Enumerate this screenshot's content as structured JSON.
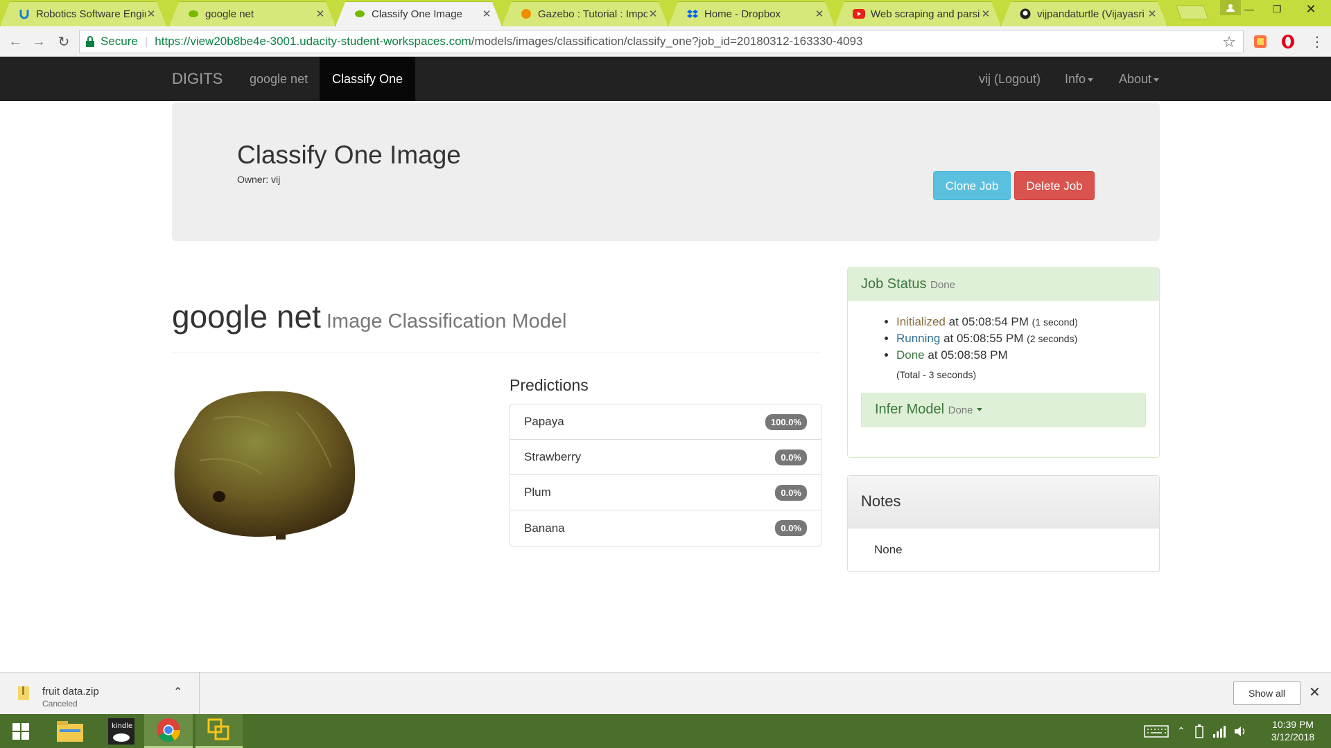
{
  "browser": {
    "tabs": [
      {
        "title": "Robotics Software Engin",
        "favicon": "udacity-icon"
      },
      {
        "title": "google net",
        "favicon": "nvidia-icon"
      },
      {
        "title": "Classify One Image",
        "favicon": "nvidia-icon",
        "active": true
      },
      {
        "title": "Gazebo : Tutorial : Impo",
        "favicon": "gazebo-icon"
      },
      {
        "title": "Home - Dropbox",
        "favicon": "dropbox-icon"
      },
      {
        "title": "Web scraping and parsin",
        "favicon": "youtube-icon"
      },
      {
        "title": "vijpandaturtle (Vijayasri",
        "favicon": "github-icon"
      }
    ],
    "secure_label": "Secure",
    "url_host": "https://view20b8be4e-3001.udacity-student-workspaces.com",
    "url_path": "/models/images/classification/classify_one?job_id=20180312-163330-4093"
  },
  "navbar": {
    "brand": "DIGITS",
    "links": [
      "google net",
      "Classify One"
    ],
    "user": "vij (Logout)",
    "info": "Info",
    "about": "About"
  },
  "job": {
    "title": "Classify One Image",
    "owner": "Owner: vij",
    "clone_label": "Clone Job",
    "delete_label": "Delete Job"
  },
  "model": {
    "name": "google net",
    "subtitle": "Image Classification Model"
  },
  "predictions": {
    "title": "Predictions",
    "items": [
      {
        "label": "Papaya",
        "value": "100.0%"
      },
      {
        "label": "Strawberry",
        "value": "0.0%"
      },
      {
        "label": "Plum",
        "value": "0.0%"
      },
      {
        "label": "Banana",
        "value": "0.0%"
      }
    ]
  },
  "status": {
    "title": "Job Status",
    "state": "Done",
    "events": [
      {
        "name": "Initialized",
        "time": "at 05:08:54 PM",
        "duration": "(1 second)"
      },
      {
        "name": "Running",
        "time": "at 05:08:55 PM",
        "duration": "(2 seconds)"
      },
      {
        "name": "Done",
        "time": "at 05:08:58 PM",
        "duration": ""
      }
    ],
    "total": "(Total - 3 seconds)",
    "infer_label": "Infer Model",
    "infer_state": "Done"
  },
  "notes": {
    "title": "Notes",
    "body": "None"
  },
  "downloads": {
    "file": "fruit data.zip",
    "status": "Canceled",
    "show_all": "Show all"
  },
  "taskbar": {
    "time": "10:39 PM",
    "date": "3/12/2018"
  }
}
